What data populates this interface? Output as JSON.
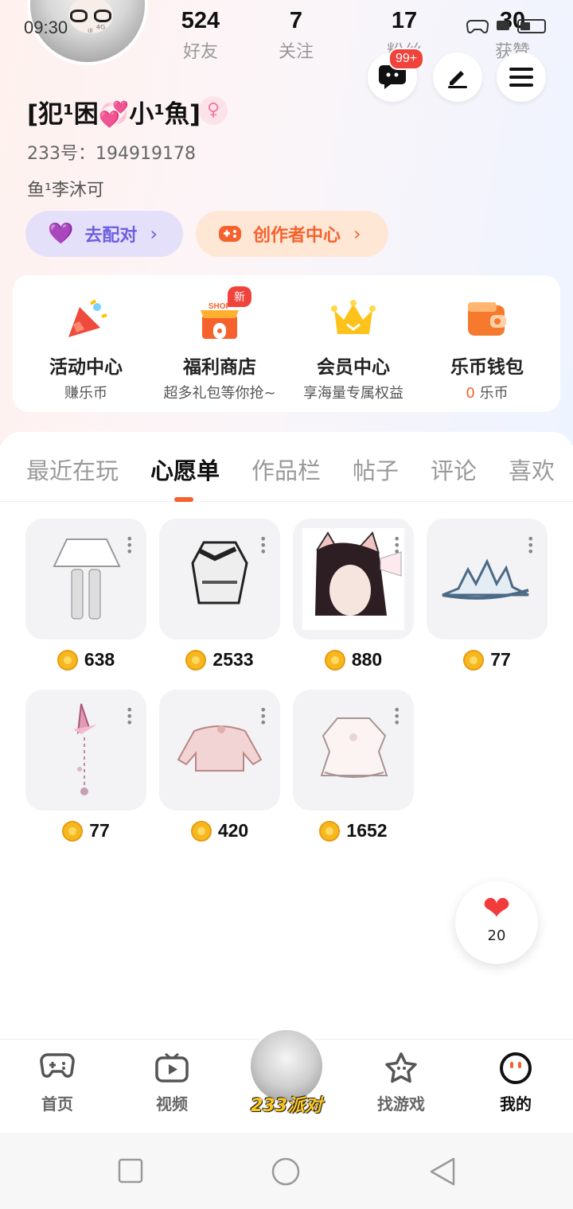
{
  "status_bar": {
    "time": "09:30",
    "signal_text": "ᵢₗₗ ⁴ᴳ",
    "battery": "30"
  },
  "profile": {
    "stats": [
      {
        "value": "524",
        "label": "好友"
      },
      {
        "value": "7",
        "label": "关注"
      },
      {
        "value": "17",
        "label": "粉丝"
      },
      {
        "value": "30",
        "label": "获赞"
      }
    ],
    "message_badge": "99+",
    "username": "[犯¹困💞小¹魚]",
    "gender_symbol": "♀",
    "uid": "233号：194919178",
    "signature": "鱼¹李沐可",
    "pair_button": "去配对",
    "creator_button": "创作者中心"
  },
  "entries": [
    {
      "title": "活动中心",
      "sub": "赚乐币"
    },
    {
      "title": "福利商店",
      "sub": "超多礼包等你抢~",
      "tag": "新",
      "shop_sign": "SHOP"
    },
    {
      "title": "会员中心",
      "sub": "享海量专属权益"
    },
    {
      "title": "乐币钱包",
      "sub_value": "0",
      "sub_unit": " 乐币"
    }
  ],
  "tabs": [
    "最近在玩",
    "心愿单",
    "作品栏",
    "帖子",
    "评论",
    "喜欢"
  ],
  "active_tab": "心愿单",
  "wishlist": [
    {
      "price": "638"
    },
    {
      "price": "2533"
    },
    {
      "price": "880"
    },
    {
      "price": "77"
    },
    {
      "price": "77"
    },
    {
      "price": "420"
    },
    {
      "price": "1652"
    }
  ],
  "like_count": "20",
  "bottom_nav": [
    {
      "label": "首页",
      "icon": "gamepad-icon"
    },
    {
      "label": "视频",
      "icon": "tv-play-icon"
    },
    {
      "label": "233派对",
      "icon": "party-avatar"
    },
    {
      "label": "找游戏",
      "icon": "star-search-icon"
    },
    {
      "label": "我的",
      "icon": "me-face-icon"
    }
  ],
  "colors": {
    "accent": "#f5622d",
    "pair": "#6b5fe0",
    "badge": "#f0433b",
    "coin": "#f6b81f"
  }
}
